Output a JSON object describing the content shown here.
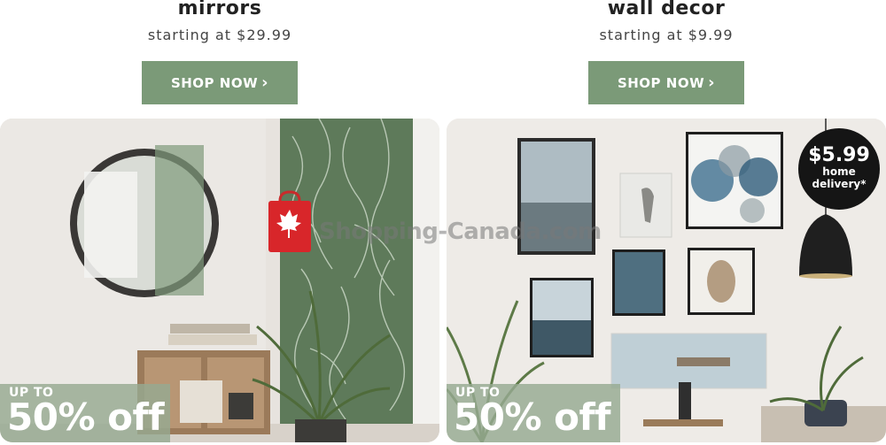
{
  "categories": [
    {
      "title": "mirrors",
      "subtitle": "starting at $29.99",
      "button_label": "SHOP NOW",
      "promo": {
        "up_to": "UP TO",
        "discount": "50% off"
      }
    },
    {
      "title": "wall decor",
      "subtitle": "starting at $9.99",
      "button_label": "SHOP NOW",
      "promo": {
        "up_to": "UP TO",
        "discount": "50% off"
      }
    }
  ],
  "delivery_badge": {
    "price": "$5.99",
    "line1": "home",
    "line2": "delivery*"
  },
  "watermark": {
    "text": "Shopping-Canada.com"
  },
  "colors": {
    "accent": "#7b9a78",
    "badge": "#151515",
    "promo_overlay": "#96aa91"
  },
  "icons": {
    "chevron": "chevron-right-icon",
    "logo": "maple-leaf-bag-icon"
  }
}
